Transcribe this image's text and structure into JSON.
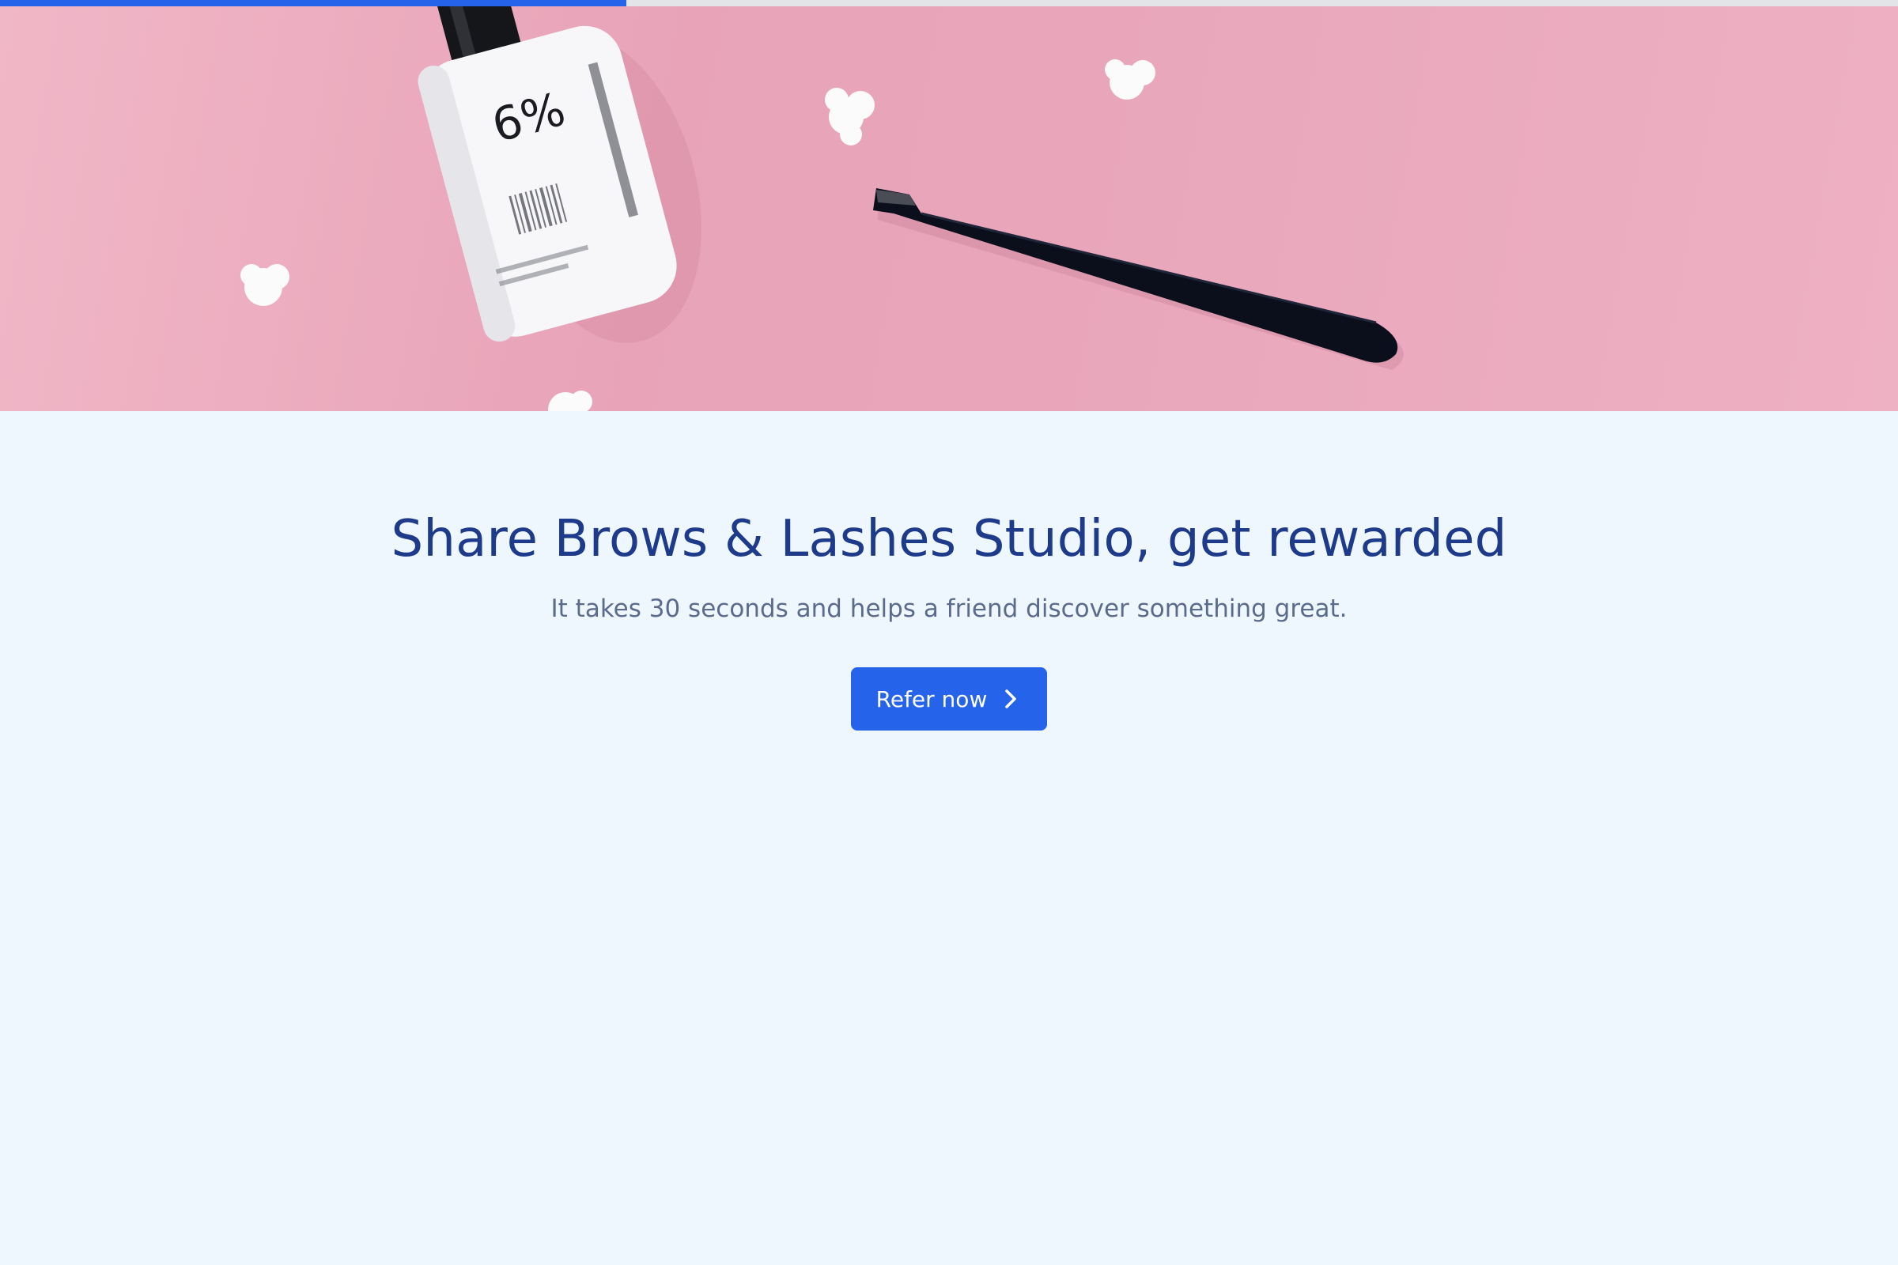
{
  "progress": {
    "value": 0.33
  },
  "hero": {
    "image": "pink-background-with-lotion-bottle-tweezers-and-flowers",
    "bottle_label": "6%"
  },
  "headline": "Share Brows & Lashes Studio, get rewarded",
  "subheadline": "It takes 30 seconds and helps a friend discover something great.",
  "cta": {
    "label": "Refer now",
    "icon": "chevron-right-icon"
  },
  "colors": {
    "accent": "#2563eb",
    "title": "#1e3a8a",
    "subtitle": "#5b6b8c",
    "background": "#eef6fe",
    "hero_bg": "#e9a7bb"
  }
}
